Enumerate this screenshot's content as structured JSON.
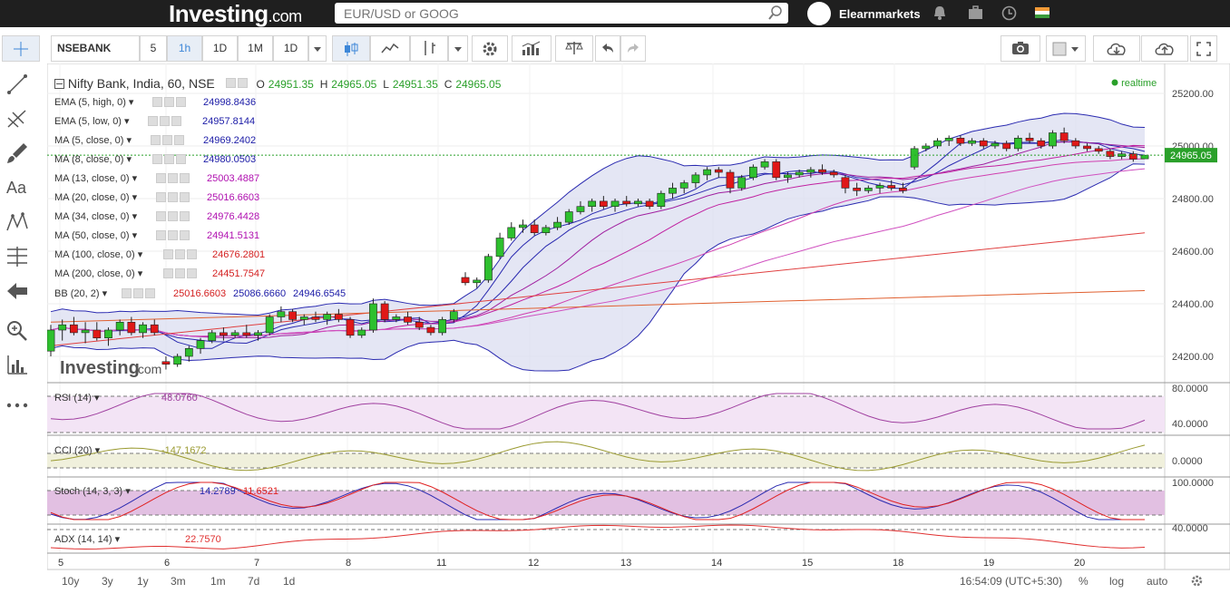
{
  "header": {
    "logo": "Investing",
    "logo_suffix": ".com",
    "search_placeholder": "EUR/USD or GOOG",
    "username": "Elearnmarkets"
  },
  "toolbar": {
    "symbol": "NSEBANK",
    "intervals": [
      "5",
      "1h",
      "1D",
      "1M",
      "1D"
    ],
    "active_interval": "1h"
  },
  "chart_title": {
    "name": "Nifty Bank, India, 60, NSE",
    "o_label": "O",
    "o": "24951.35",
    "h_label": "H",
    "h": "24965.05",
    "l_label": "L",
    "l": "24951.35",
    "c_label": "C",
    "c": "24965.05",
    "realtime": "realtime"
  },
  "indicators": [
    {
      "name": "EMA (5, high, 0)",
      "value": "24998.8436",
      "color": "#1a1aa6"
    },
    {
      "name": "EMA (5, low, 0)",
      "value": "24957.8144",
      "color": "#1a1aa6"
    },
    {
      "name": "MA (5, close, 0)",
      "value": "24969.2402",
      "color": "#1a1aa6"
    },
    {
      "name": "MA (8, close, 0)",
      "value": "24980.0503",
      "color": "#1a1aa6"
    },
    {
      "name": "MA (13, close, 0)",
      "value": "25003.4887",
      "color": "#b010b0"
    },
    {
      "name": "MA (20, close, 0)",
      "value": "25016.6603",
      "color": "#b010b0"
    },
    {
      "name": "MA (34, close, 0)",
      "value": "24976.4428",
      "color": "#b010b0"
    },
    {
      "name": "MA (50, close, 0)",
      "value": "24941.5131",
      "color": "#b010b0"
    },
    {
      "name": "MA (100, close, 0)",
      "value": "24676.2801",
      "color": "#d42020"
    },
    {
      "name": "MA (200, close, 0)",
      "value": "24451.7547",
      "color": "#d42020"
    }
  ],
  "bb": {
    "name": "BB (20, 2)",
    "v1": "25016.6603",
    "v1_color": "#d42020",
    "v2": "25086.6660",
    "v2_color": "#1a1aa6",
    "v3": "24946.6545",
    "v3_color": "#1a1aa6"
  },
  "watermark": {
    "logo": "Investing",
    "suffix": ".com"
  },
  "price_axis": {
    "ticks": [
      "25200.00",
      "25000.00",
      "24800.00",
      "24600.00",
      "24400.00",
      "24200.00"
    ],
    "current": "24965.05"
  },
  "time_axis": {
    "ticks": [
      "5",
      "6",
      "7",
      "8",
      "11",
      "12",
      "13",
      "14",
      "15",
      "18",
      "19",
      "20"
    ]
  },
  "rsi": {
    "name": "RSI (14)",
    "value": "48.0760",
    "ticks": [
      "80.0000",
      "40.0000"
    ]
  },
  "cci": {
    "name": "CCI (20)",
    "value": "-147.1672",
    "ticks": [
      "0.0000"
    ]
  },
  "stoch": {
    "name": "Stoch (14, 3, 3)",
    "value1": "14.2789",
    "value2": "11.6521",
    "ticks": [
      "100.0000"
    ]
  },
  "adx": {
    "name": "ADX (14, 14)",
    "value": "22.7570",
    "ticks": [
      "40.0000"
    ]
  },
  "footer": {
    "ranges": [
      "10y",
      "3y",
      "1y",
      "3m",
      "1m",
      "7d",
      "1d"
    ],
    "time": "16:54:09 (UTC+5:30)",
    "percent": "%",
    "log": "log",
    "auto": "auto"
  },
  "chart_data": {
    "type": "candlestick",
    "title": "Nifty Bank, India, 60, NSE",
    "x_ticks": [
      "5",
      "6",
      "7",
      "8",
      "11",
      "12",
      "13",
      "14",
      "15",
      "18",
      "19",
      "20"
    ],
    "ylim": [
      24100,
      25300
    ],
    "y_ticks": [
      24200,
      24400,
      24600,
      24800,
      25000,
      25200
    ],
    "candles": [
      [
        24220,
        24320,
        24200,
        24300
      ],
      [
        24300,
        24340,
        24260,
        24320
      ],
      [
        24320,
        24350,
        24280,
        24290
      ],
      [
        24290,
        24330,
        24250,
        24300
      ],
      [
        24300,
        24330,
        24260,
        24270
      ],
      [
        24270,
        24310,
        24240,
        24300
      ],
      [
        24300,
        24340,
        24280,
        24330
      ],
      [
        24330,
        24350,
        24280,
        24290
      ],
      [
        24290,
        24330,
        24270,
        24320
      ],
      [
        24320,
        24340,
        24280,
        24290
      ],
      [
        24180,
        24200,
        24150,
        24170
      ],
      [
        24170,
        24210,
        24160,
        24200
      ],
      [
        24200,
        24240,
        24180,
        24230
      ],
      [
        24230,
        24270,
        24210,
        24260
      ],
      [
        24260,
        24300,
        24250,
        24290
      ],
      [
        24290,
        24310,
        24260,
        24280
      ],
      [
        24280,
        24300,
        24270,
        24290
      ],
      [
        24290,
        24320,
        24270,
        24280
      ],
      [
        24280,
        24300,
        24260,
        24290
      ],
      [
        24290,
        24360,
        24280,
        24350
      ],
      [
        24350,
        24390,
        24330,
        24370
      ],
      [
        24370,
        24380,
        24330,
        24340
      ],
      [
        24340,
        24360,
        24320,
        24350
      ],
      [
        24350,
        24370,
        24330,
        24340
      ],
      [
        24340,
        24370,
        24320,
        24360
      ],
      [
        24360,
        24380,
        24330,
        24340
      ],
      [
        24340,
        24350,
        24270,
        24280
      ],
      [
        24280,
        24310,
        24270,
        24300
      ],
      [
        24300,
        24420,
        24290,
        24400
      ],
      [
        24400,
        24410,
        24330,
        24340
      ],
      [
        24340,
        24360,
        24330,
        24350
      ],
      [
        24350,
        24370,
        24320,
        24330
      ],
      [
        24330,
        24350,
        24300,
        24310
      ],
      [
        24310,
        24320,
        24280,
        24290
      ],
      [
        24290,
        24350,
        24280,
        24340
      ],
      [
        24340,
        24380,
        24330,
        24370
      ],
      [
        24500,
        24520,
        24470,
        24480
      ],
      [
        24480,
        24500,
        24460,
        24490
      ],
      [
        24490,
        24590,
        24480,
        24580
      ],
      [
        24580,
        24670,
        24570,
        24650
      ],
      [
        24650,
        24710,
        24640,
        24690
      ],
      [
        24690,
        24720,
        24670,
        24700
      ],
      [
        24700,
        24720,
        24660,
        24670
      ],
      [
        24670,
        24700,
        24660,
        24690
      ],
      [
        24690,
        24730,
        24680,
        24710
      ],
      [
        24710,
        24760,
        24700,
        24750
      ],
      [
        24750,
        24790,
        24740,
        24770
      ],
      [
        24770,
        24800,
        24750,
        24790
      ],
      [
        24790,
        24810,
        24760,
        24770
      ],
      [
        24770,
        24800,
        24750,
        24790
      ],
      [
        24790,
        24810,
        24770,
        24780
      ],
      [
        24780,
        24800,
        24770,
        24790
      ],
      [
        24790,
        24800,
        24760,
        24770
      ],
      [
        24770,
        24830,
        24760,
        24820
      ],
      [
        24820,
        24860,
        24800,
        24840
      ],
      [
        24840,
        24870,
        24820,
        24860
      ],
      [
        24860,
        24900,
        24840,
        24890
      ],
      [
        24890,
        24920,
        24870,
        24910
      ],
      [
        24910,
        24920,
        24880,
        24900
      ],
      [
        24900,
        24910,
        24820,
        24840
      ],
      [
        24840,
        24890,
        24830,
        24880
      ],
      [
        24880,
        24930,
        24870,
        24920
      ],
      [
        24920,
        24950,
        24910,
        24940
      ],
      [
        24940,
        24950,
        24870,
        24880
      ],
      [
        24880,
        24900,
        24860,
        24890
      ],
      [
        24890,
        24910,
        24880,
        24900
      ],
      [
        24900,
        24920,
        24880,
        24910
      ],
      [
        24910,
        24930,
        24890,
        24900
      ],
      [
        24900,
        24910,
        24880,
        24890
      ],
      [
        24880,
        24890,
        24820,
        24840
      ],
      [
        24840,
        24860,
        24810,
        24830
      ],
      [
        24830,
        24850,
        24820,
        24840
      ],
      [
        24840,
        24860,
        24820,
        24850
      ],
      [
        24850,
        24870,
        24830,
        24840
      ],
      [
        24840,
        24860,
        24820,
        24830
      ],
      [
        24920,
        25000,
        24910,
        24990
      ],
      [
        24990,
        25010,
        24980,
        25000
      ],
      [
        25000,
        25030,
        24990,
        25020
      ],
      [
        25020,
        25040,
        25000,
        25030
      ],
      [
        25030,
        25040,
        25000,
        25010
      ],
      [
        25010,
        25030,
        25000,
        25020
      ],
      [
        25020,
        25030,
        24990,
        25000
      ],
      [
        25000,
        25020,
        24990,
        25010
      ],
      [
        25010,
        25020,
        24980,
        24990
      ],
      [
        24990,
        25040,
        24980,
        25030
      ],
      [
        25030,
        25050,
        25010,
        25020
      ],
      [
        25020,
        25030,
        24990,
        25000
      ],
      [
        25000,
        25060,
        24990,
        25050
      ],
      [
        25050,
        25070,
        25010,
        25020
      ],
      [
        25020,
        25030,
        24990,
        25000
      ],
      [
        25000,
        25010,
        24980,
        24990
      ],
      [
        24990,
        25000,
        24970,
        24980
      ],
      [
        24980,
        24990,
        24950,
        24960
      ],
      [
        24960,
        24980,
        24950,
        24970
      ],
      [
        24970,
        24980,
        24940,
        24950
      ],
      [
        24951.35,
        24965.05,
        24951.35,
        24965.05
      ]
    ]
  }
}
